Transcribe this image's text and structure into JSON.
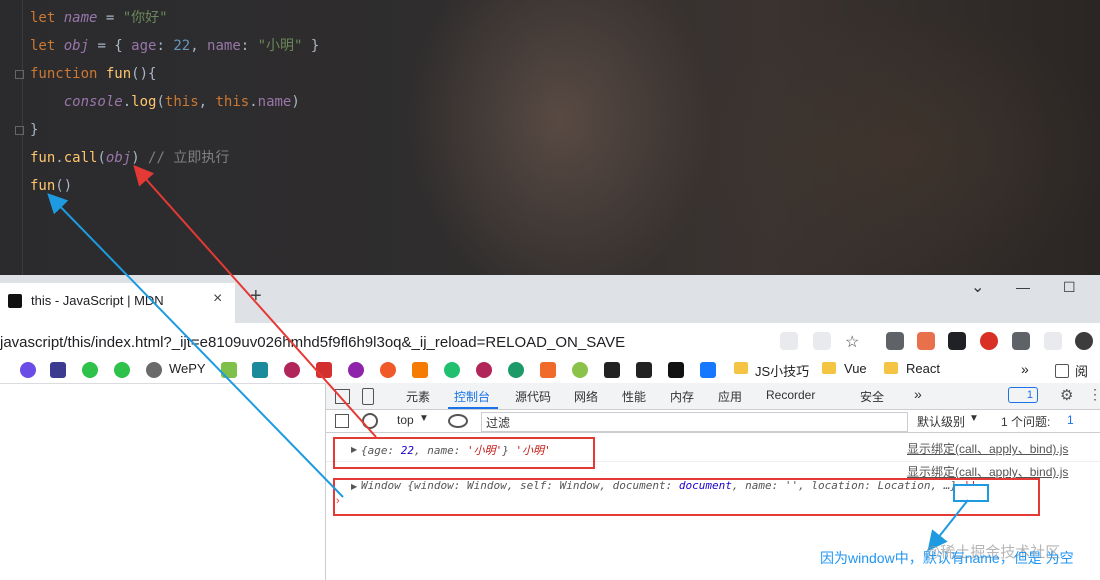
{
  "editor": {
    "lines": [
      {
        "parts": [
          [
            "kw",
            "let "
          ],
          [
            "var",
            "name"
          ],
          [
            "plain",
            " = "
          ],
          [
            "str",
            "\"你好\""
          ]
        ]
      },
      {
        "parts": [
          [
            "kw",
            "let "
          ],
          [
            "var",
            "obj"
          ],
          [
            "plain",
            " = { "
          ],
          [
            "prop",
            "age"
          ],
          [
            "plain",
            ": "
          ],
          [
            "num",
            "22"
          ],
          [
            "plain",
            ", "
          ],
          [
            "prop",
            "name"
          ],
          [
            "plain",
            ": "
          ],
          [
            "str",
            "\"小明\""
          ],
          [
            "plain",
            " }"
          ]
        ]
      },
      {
        "parts": [
          [
            "kw",
            "function "
          ],
          [
            "fn",
            "fun"
          ],
          [
            "plain",
            "(){"
          ]
        ]
      },
      {
        "parts": [
          [
            "plain",
            "    "
          ],
          [
            "var",
            "console"
          ],
          [
            "plain",
            "."
          ],
          [
            "fn",
            "log"
          ],
          [
            "plain",
            "("
          ],
          [
            "this",
            "this"
          ],
          [
            "plain",
            ", "
          ],
          [
            "this",
            "this"
          ],
          [
            "plain",
            "."
          ],
          [
            "prop",
            "name"
          ],
          [
            "plain",
            ")"
          ]
        ]
      },
      {
        "parts": [
          [
            "plain",
            "}"
          ]
        ]
      },
      {
        "parts": [
          [
            "fn",
            "fun"
          ],
          [
            "plain",
            "."
          ],
          [
            "fn",
            "call"
          ],
          [
            "plain",
            "("
          ],
          [
            "var",
            "obj"
          ],
          [
            "plain",
            ") "
          ],
          [
            "cmt",
            "// 立即执行"
          ]
        ]
      },
      {
        "parts": [
          [
            "fn",
            "fun"
          ],
          [
            "plain",
            "()"
          ]
        ]
      }
    ]
  },
  "browser": {
    "tab_title": "this - JavaScript | MDN",
    "tab_close": "×",
    "new_tab": "+",
    "window_controls": {
      "minimize": "—",
      "maximize": "☐",
      "chevron": "⌄"
    },
    "url": "javascript/this/index.html?_ijt=e8109uv026hmhd5f9fl6h9l3oq&_ij_reload=RELOAD_ON_SAVE",
    "bookmarks": [
      "WePY",
      "JS小技巧",
      "Vue",
      "React",
      "阅读"
    ],
    "bookmark_overflow": "»"
  },
  "devtools": {
    "tabs": [
      "元素",
      "控制台",
      "源代码",
      "网络",
      "性能",
      "内存",
      "应用",
      "Recorder",
      "安全"
    ],
    "active_tab": "控制台",
    "more_tabs": "»",
    "issue_badge": "1",
    "context": "top",
    "filter_placeholder": "过滤",
    "level": "默认级别",
    "issues": "1 个问题:",
    "issues_count": "1",
    "messages": [
      {
        "text_parts": [
          [
            "m-key",
            "{age: "
          ],
          [
            "m-num",
            "22"
          ],
          [
            "m-key",
            ", name: "
          ],
          [
            "m-str",
            "'小明'"
          ],
          [
            "m-key",
            "} "
          ],
          [
            "m-str",
            "'小明'"
          ]
        ],
        "source": "显示绑定(call、apply、bind).js"
      },
      {
        "text_parts": [
          [
            "m-key",
            "Window {window: Window, self: Window, document: "
          ],
          [
            "m-num",
            "document"
          ],
          [
            "m-key",
            ", name: '', location: Location, …} "
          ],
          [
            "m-str",
            "''"
          ]
        ],
        "source": "显示绑定(call、apply、bind).js"
      }
    ]
  },
  "annotation": "因为window中，默认有name，但是 为空",
  "watermark": "@稀土掘金技术社区",
  "colors": {
    "red_arrow": "#e53935",
    "blue_arrow": "#1e9be0",
    "blue_box": "#2196f3"
  }
}
